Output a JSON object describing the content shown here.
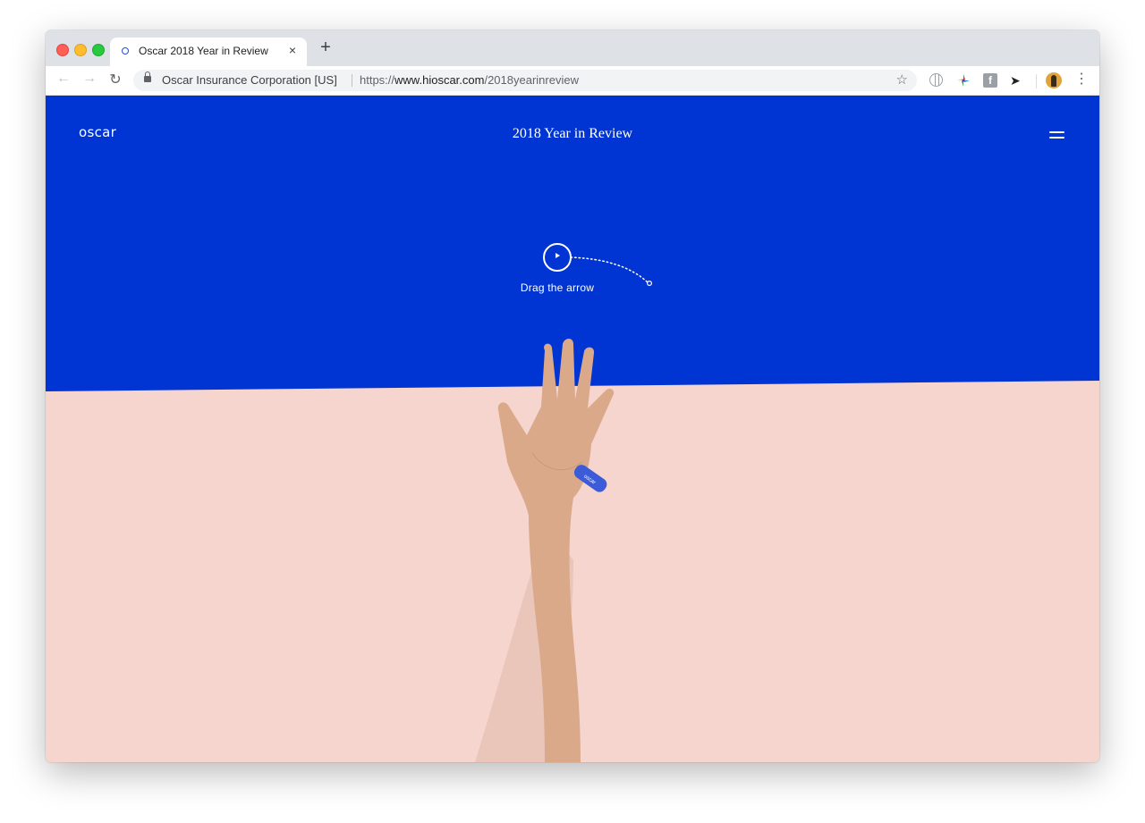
{
  "browser": {
    "tab": {
      "title": "Oscar 2018 Year in Review",
      "close": "×"
    },
    "new_tab": "+",
    "nav": {
      "back": "←",
      "forward": "→",
      "reload": "↻"
    },
    "site_identity": "Oscar Insurance Corporation [US]",
    "url": {
      "scheme": "https://",
      "host": "www.hioscar.com",
      "path": "/2018yearinreview"
    },
    "star": "☆",
    "menu": "⋮",
    "extensions": [
      "globe-icon",
      "pinwheel-icon",
      "facebook-icon",
      "bird-icon"
    ],
    "fb_glyph": "f",
    "bird_glyph": "➤"
  },
  "page": {
    "logo": "oscar",
    "title": "2018 Year in Review",
    "drag_label": "Drag the arrow",
    "bandage_text": "oscar"
  },
  "colors": {
    "blue": "#0035d3",
    "pink": "#f5d5cd",
    "skin": "#d9a98a",
    "bandage": "#3b5bd9"
  }
}
